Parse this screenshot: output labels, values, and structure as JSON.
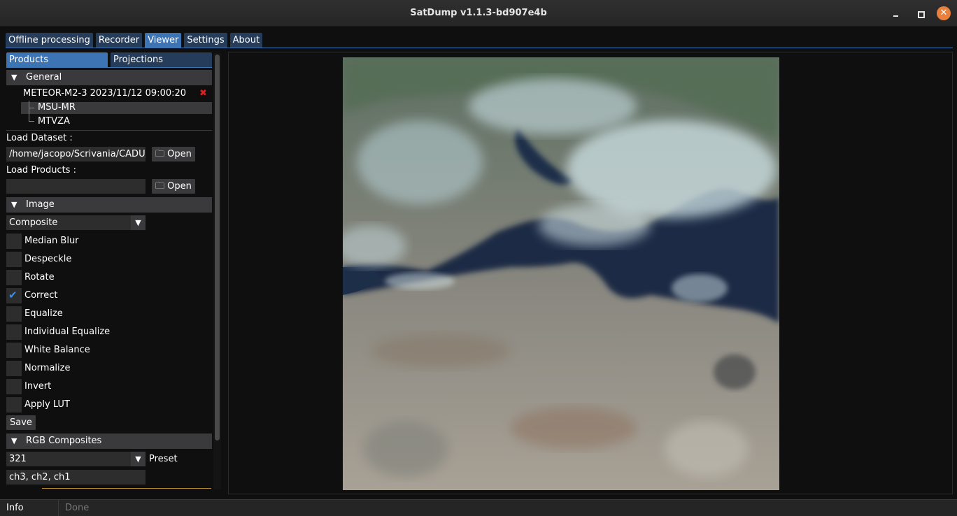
{
  "window": {
    "title": "SatDump v1.1.3-bd907e4b",
    "minimize_icon": "minimize-icon",
    "maximize_icon": "maximize-icon",
    "close_icon": "close-icon",
    "close_color": "#e9803d"
  },
  "main_tabs": [
    {
      "label": "Offline processing",
      "active": false
    },
    {
      "label": "Recorder",
      "active": false
    },
    {
      "label": "Viewer",
      "active": true
    },
    {
      "label": "Settings",
      "active": false
    },
    {
      "label": "About",
      "active": false
    }
  ],
  "sub_tabs": [
    {
      "label": "Products",
      "active": true
    },
    {
      "label": "Projections",
      "active": false
    }
  ],
  "general": {
    "header": "General",
    "dataset_name": "METEOR-M2-3 2023/11/12 09:00:20",
    "instruments": [
      "MSU-MR",
      "MTVZA"
    ],
    "selected_instrument": "MSU-MR",
    "load_dataset_label": "Load Dataset :",
    "load_dataset_value": "/home/jacopo/Scrivania/CADU/(",
    "load_products_label": "Load Products :",
    "load_products_value": "",
    "open_label": "Open",
    "folder_icon": "folder-icon"
  },
  "image": {
    "header": "Image",
    "mode": "Composite",
    "options": [
      {
        "label": "Median Blur",
        "checked": false
      },
      {
        "label": "Despeckle",
        "checked": false
      },
      {
        "label": "Rotate",
        "checked": false
      },
      {
        "label": "Correct",
        "checked": true
      },
      {
        "label": "Equalize",
        "checked": false
      },
      {
        "label": "Individual Equalize",
        "checked": false
      },
      {
        "label": "White Balance",
        "checked": false
      },
      {
        "label": "Normalize",
        "checked": false
      },
      {
        "label": "Invert",
        "checked": false
      },
      {
        "label": "Apply LUT",
        "checked": false
      }
    ],
    "save_label": "Save"
  },
  "rgb": {
    "header": "RGB Composites",
    "composite": "321",
    "preset_label": "Preset",
    "channels": "ch3, ch2, ch1"
  },
  "status": {
    "label": "Info",
    "text": "Done"
  },
  "colors": {
    "accent": "#3d74b4",
    "tab_inactive": "#253c5b",
    "check": "#3d8ee6",
    "remove_x": "#e0201e"
  }
}
